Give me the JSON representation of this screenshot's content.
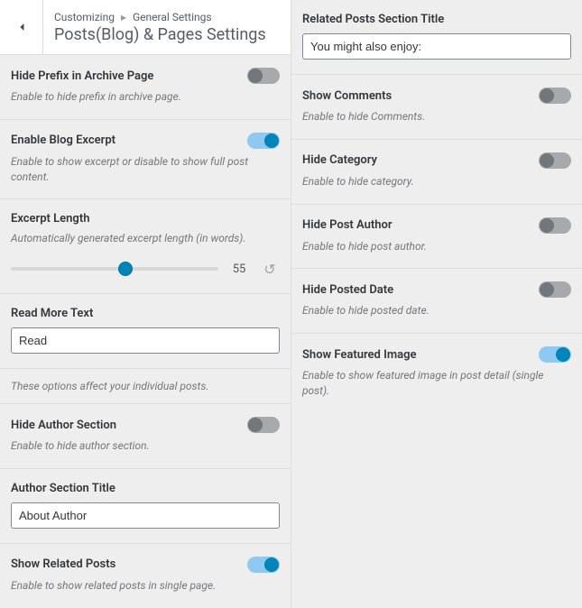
{
  "header": {
    "breadcrumb_root": "Customizing",
    "breadcrumb_parent": "General Settings",
    "title": "Posts(Blog) & Pages Settings"
  },
  "left": {
    "hide_prefix": {
      "label": "Hide Prefix in Archive Page",
      "desc": "Enable to hide prefix in archive page.",
      "on": false
    },
    "blog_excerpt": {
      "label": "Enable Blog Excerpt",
      "desc": "Enable to show excerpt or disable to show full post content.",
      "on": true
    },
    "excerpt_length": {
      "label": "Excerpt Length",
      "desc": "Automatically generated excerpt length (in words).",
      "value": 55,
      "max": 100
    },
    "read_more": {
      "label": "Read More Text",
      "value": "Read"
    },
    "note": "These options affect your individual posts.",
    "hide_author": {
      "label": "Hide Author Section",
      "desc": "Enable to hide author section.",
      "on": false
    },
    "author_title": {
      "label": "Author Section Title",
      "value": "About Author"
    },
    "related_posts": {
      "label": "Show Related Posts",
      "desc": "Enable to show related posts in single page.",
      "on": true
    }
  },
  "right": {
    "related_title": {
      "label": "Related Posts Section Title",
      "value": "You might also enjoy:"
    },
    "show_comments": {
      "label": "Show Comments",
      "desc": "Enable to hide Comments.",
      "on": false
    },
    "hide_category": {
      "label": "Hide Category",
      "desc": "Enable to hide category.",
      "on": false
    },
    "hide_author": {
      "label": "Hide Post Author",
      "desc": "Enable to hide post author.",
      "on": false
    },
    "hide_date": {
      "label": "Hide Posted Date",
      "desc": "Enable to hide posted date.",
      "on": false
    },
    "featured_image": {
      "label": "Show Featured Image",
      "desc": "Enable to show featured image in post detail (single post).",
      "on": true
    }
  }
}
